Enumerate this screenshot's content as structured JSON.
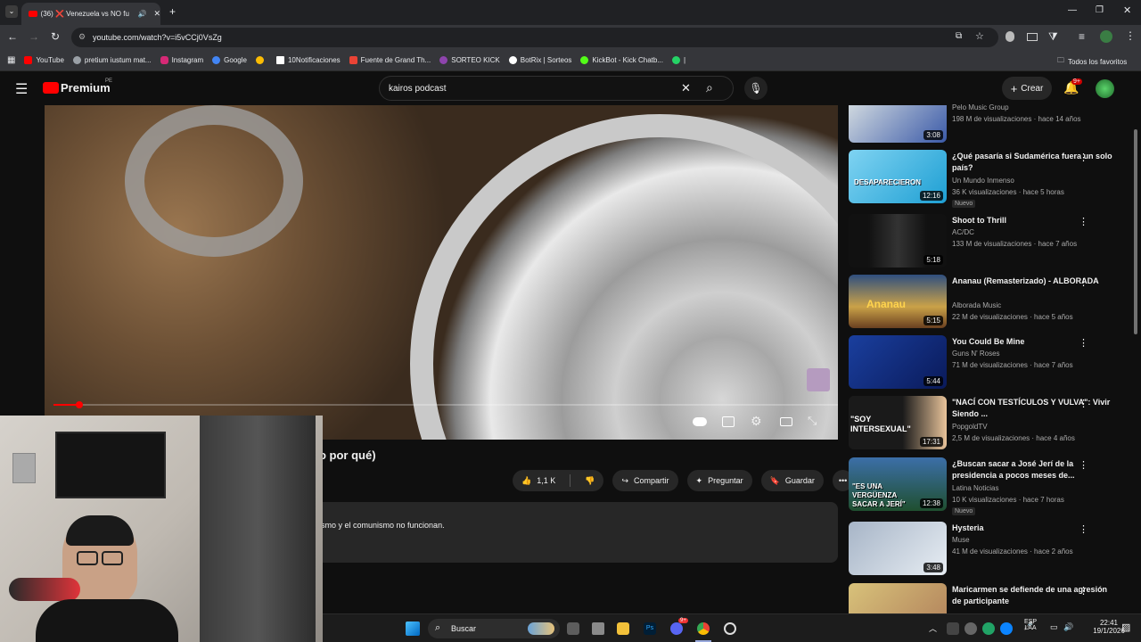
{
  "browser": {
    "tab": {
      "title": "(36) ❌ Venezuela vs NO fu"
    },
    "url": "youtube.com/watch?v=i5vCCj0VsZg",
    "bookmarks": [
      {
        "label": "YouTube",
        "color": "#ff0000"
      },
      {
        "label": "pretium iustum mat...",
        "color": "#9aa0a6"
      },
      {
        "label": "Instagram",
        "color": "#d62976"
      },
      {
        "label": "Google",
        "color": "#4285f4"
      },
      {
        "label": "",
        "color": "#fbbc04"
      },
      {
        "label": "10Notificaciones",
        "color": "#ffffff"
      },
      {
        "label": "Fuente de Grand Th...",
        "color": "#ea4335"
      },
      {
        "label": "SORTEO KICK",
        "color": "#8e44ad"
      },
      {
        "label": "BotRix | Sorteos",
        "color": "#ffffff"
      },
      {
        "label": "KickBot - Kick Chatb...",
        "color": "#53fc18"
      },
      {
        "label": "|",
        "color": "#25d366"
      }
    ],
    "all_favorites": "Todos los favoritos"
  },
  "youtube": {
    "logo_text": "Premium",
    "logo_region": "PE",
    "search_value": "kairos podcast",
    "create_label": "Crear",
    "notif_badge": "9+"
  },
  "video": {
    "progress_fraction": 0.034,
    "title_partial": "o por qué)",
    "likes": "1,1 K",
    "share_label": "Compartir",
    "ask_label": "Preguntar",
    "save_label": "Guardar",
    "description_partial": "smo y el comunismo no funcionan."
  },
  "sidebar": {
    "cards": [
      {
        "title": "",
        "channel": "Pelo Music Group",
        "meta": "198 M de visualizaciones · hace 14 años",
        "duration": "3:08",
        "new": ""
      },
      {
        "title": "¿Qué pasaría si Sudamérica fuera un solo país?",
        "channel": "Un Mundo Inmenso",
        "meta": "36 K visualizaciones · hace 5 horas",
        "duration": "12:16",
        "new": "Nuevo",
        "thumb_text": "DESAPARECIERON"
      },
      {
        "title": "Shoot to Thrill",
        "channel": "AC/DC",
        "meta": "133 M de visualizaciones · hace 7 años",
        "duration": "5:18",
        "new": ""
      },
      {
        "title": "Ananau (Remasterizado) - ALBORADA",
        "channel": "Alborada Music",
        "meta": "22 M de visualizaciones · hace 5 años",
        "duration": "5:15",
        "new": "",
        "thumb_text": "Ananau"
      },
      {
        "title": "You Could Be Mine",
        "channel": "Guns N' Roses",
        "meta": "71 M de visualizaciones · hace 7 años",
        "duration": "5:44",
        "new": ""
      },
      {
        "title": "\"NACÍ CON TESTÍCULOS Y VULVA\": Vivir Siendo ...",
        "channel": "PopgoldTV",
        "meta": "2,5 M de visualizaciones · hace 4 años",
        "duration": "17:31",
        "new": "",
        "thumb_text": "\"SOY INTERSEXUAL\""
      },
      {
        "title": "¿Buscan sacar a José Jerí de la presidencia a pocos meses de...",
        "channel": "Latina Noticias",
        "meta": "10 K visualizaciones · hace 7 horas",
        "duration": "12:38",
        "new": "Nuevo",
        "thumb_text": "\"ES UNA VERGÜENZA SACAR A JERÍ\""
      },
      {
        "title": "Hysteria",
        "channel": "Muse",
        "meta": "41 M de visualizaciones · hace 2 años",
        "duration": "3:48",
        "new": ""
      },
      {
        "title": "Maricarmen se defiende de una agresión de participante",
        "channel": "",
        "meta": "",
        "duration": "",
        "new": ""
      }
    ]
  },
  "taskbar": {
    "search_label": "Buscar",
    "lang": "ESP",
    "lang_sub": "LAA",
    "time": "22:41",
    "date": "19/1/2026",
    "discord_badge": "9+"
  }
}
